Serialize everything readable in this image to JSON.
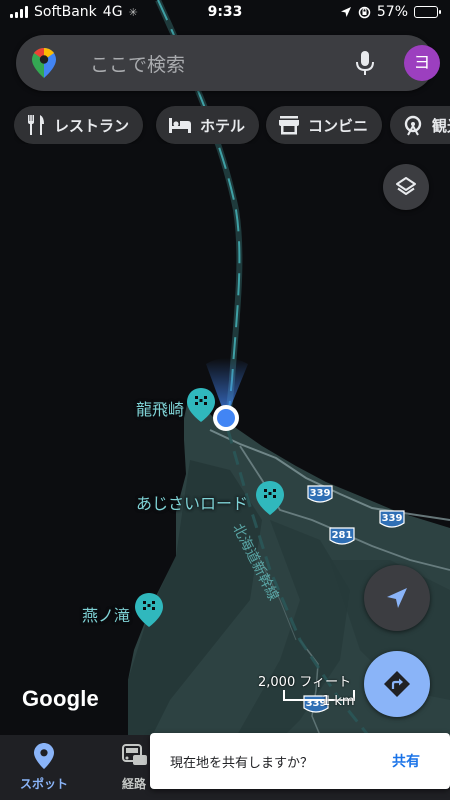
{
  "status_bar": {
    "carrier": "SoftBank",
    "network": "4G",
    "time": "9:33",
    "battery": "57%",
    "battery_level": 0.57
  },
  "search": {
    "placeholder": "ここで検索",
    "avatar_initial": "ヨ"
  },
  "chips": [
    {
      "label": "レストラン",
      "icon": "restaurant-icon"
    },
    {
      "label": "ホテル",
      "icon": "hotel-icon"
    },
    {
      "label": "コンビニ",
      "icon": "store-icon"
    },
    {
      "label": "観光",
      "icon": "attraction-icon"
    }
  ],
  "map": {
    "places": [
      {
        "name": "龍飛崎"
      },
      {
        "name": "あじさいロード"
      },
      {
        "name": "燕ノ滝"
      }
    ],
    "route_shields": [
      "339",
      "339",
      "281",
      "339"
    ],
    "rail_label": "北海道新幹線",
    "scale": {
      "imperial": "2,000 フィート",
      "metric": "1 km"
    },
    "attribution": "Google"
  },
  "bottom_nav": [
    {
      "label": "スポット",
      "icon": "pin-icon",
      "active": true
    },
    {
      "label": "経路",
      "icon": "commute-icon",
      "active": false
    }
  ],
  "snackbar": {
    "message": "現在地を共有しますか？",
    "action": "共有"
  },
  "colors": {
    "map_background": "#0c0d10",
    "land": "#2f4444",
    "water": "#0c0d10",
    "rail_line": "#3fa0a5",
    "poi_label": "#7fd3d6",
    "accent_blue": "#8ab4f8",
    "location_dot": "#4285f4",
    "active_nav": "#8ab4f8"
  }
}
